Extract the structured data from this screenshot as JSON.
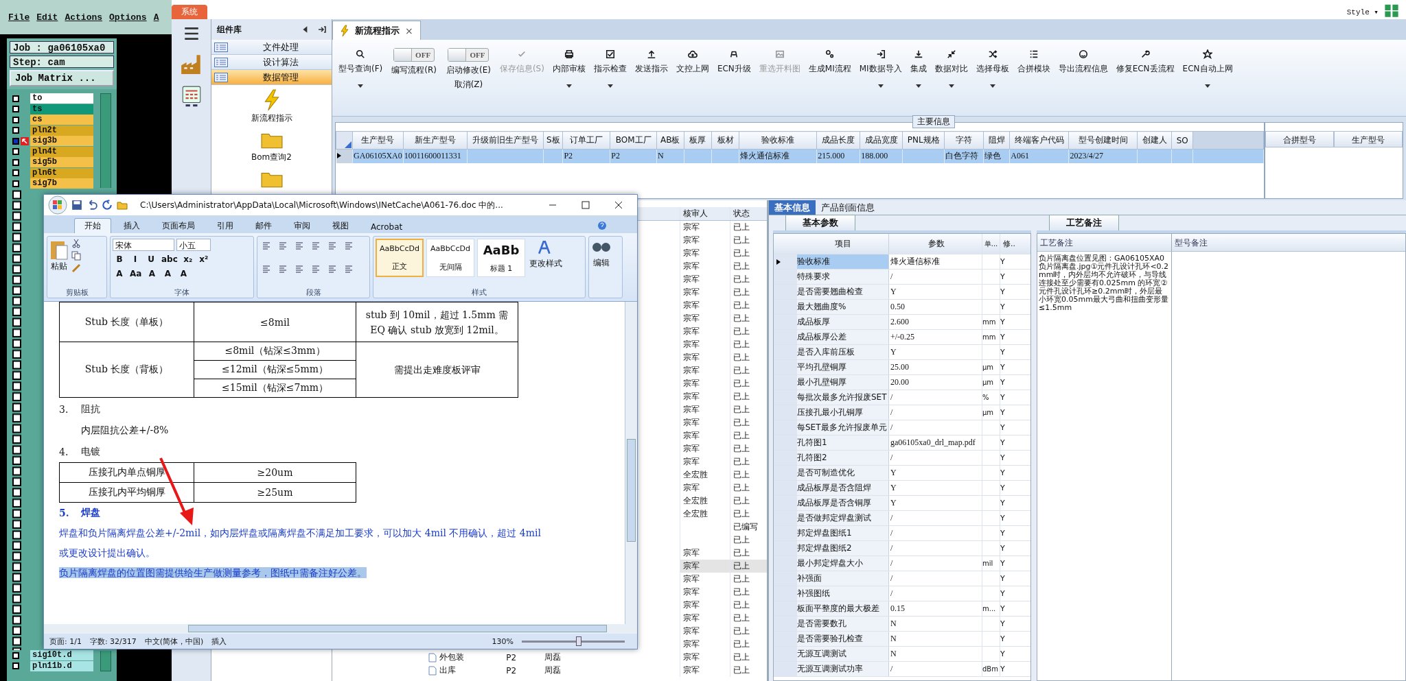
{
  "cam": {
    "menu": [
      "File",
      "Edit",
      "Actions",
      "Options",
      "A"
    ],
    "job": "Job : ga06105xa0",
    "step": "Step: cam",
    "matrix_button": "Job Matrix ...",
    "layers_top": [
      {
        "name": "to",
        "color": "#ffffff",
        "selected": false
      },
      {
        "name": "ts",
        "color": "#109878",
        "selected": false
      },
      {
        "name": "cs",
        "color": "#f4c048",
        "selected": false
      },
      {
        "name": "pln2t",
        "color": "#d8a820",
        "selected": false
      },
      {
        "name": "sig3b",
        "color": "#f4c048",
        "selected": true
      },
      {
        "name": "pln4t",
        "color": "#d8a820",
        "selected": false
      },
      {
        "name": "sig5b",
        "color": "#f4c048",
        "selected": false
      },
      {
        "name": "pln6t",
        "color": "#d8a820",
        "selected": false
      },
      {
        "name": "sig7b",
        "color": "#f4c048",
        "selected": false
      }
    ],
    "layers_bottom": [
      {
        "name": "sig10t.d",
        "color": "#a8e4e4",
        "selected": false
      },
      {
        "name": "pln11b.d",
        "color": "#a8e4e4",
        "selected": false
      }
    ]
  },
  "app": {
    "system_tab": "系统",
    "style_menu": "Style ▾"
  },
  "sidebar": {
    "title": "组件库",
    "items": [
      {
        "label": "文件处理",
        "selected": false
      },
      {
        "label": "设计算法",
        "selected": false
      },
      {
        "label": "数据管理",
        "selected": true
      }
    ],
    "tiles": [
      "新流程指示",
      "Bom查询2"
    ]
  },
  "doc_tab": {
    "label": "新流程指示",
    "close": "×"
  },
  "toolbar": [
    {
      "kind": "button",
      "label": "型号查询(F)",
      "disabled": false,
      "dropdown": true
    },
    {
      "kind": "toggle",
      "label": "编写流程(R)",
      "on": false,
      "state": "OFF"
    },
    {
      "kind": "toggle",
      "label": "启动修改(E)",
      "sublabel": "取消(Z)",
      "on": false,
      "state": "OFF"
    },
    {
      "kind": "button",
      "label": "保存信息(S)",
      "disabled": true,
      "dropdown": false
    },
    {
      "kind": "button",
      "label": "内部审核",
      "disabled": false,
      "dropdown": true
    },
    {
      "kind": "button",
      "label": "指示检查",
      "disabled": false,
      "dropdown": true
    },
    {
      "kind": "button",
      "label": "发送指示",
      "disabled": false,
      "dropdown": false
    },
    {
      "kind": "button",
      "label": "文控上网",
      "disabled": false,
      "dropdown": false
    },
    {
      "kind": "button",
      "label": "ECN升级",
      "disabled": false,
      "dropdown": false
    },
    {
      "kind": "button",
      "label": "重选开料图",
      "disabled": true,
      "dropdown": false
    },
    {
      "kind": "button",
      "label": "生成MI流程",
      "disabled": false,
      "dropdown": false
    },
    {
      "kind": "button",
      "label": "MI数据导入",
      "disabled": false,
      "dropdown": true
    },
    {
      "kind": "button",
      "label": "集成",
      "disabled": false,
      "dropdown": true
    },
    {
      "kind": "button",
      "label": "数据对比",
      "disabled": false,
      "dropdown": true
    },
    {
      "kind": "button",
      "label": "选择母板",
      "disabled": false,
      "dropdown": true
    },
    {
      "kind": "button",
      "label": "合拼模块",
      "disabled": false,
      "dropdown": false
    },
    {
      "kind": "button",
      "label": "导出流程信息",
      "disabled": false,
      "dropdown": false
    },
    {
      "kind": "button",
      "label": "修复ECN丢流程",
      "disabled": false,
      "dropdown": false
    },
    {
      "kind": "button",
      "label": "ECN自动上网",
      "disabled": false,
      "dropdown": true
    }
  ],
  "main_info": {
    "title": "主要信息",
    "columns": [
      "生产型号",
      "新生产型号",
      "升级前旧生产型号",
      "S板",
      "订单工厂",
      "BOM工厂",
      "AB板",
      "板厚",
      "板材",
      "验收标准",
      "成品长度",
      "成品宽度",
      "PNL规格",
      "字符",
      "阻焊",
      "终端客户代码",
      "型号创建时间",
      "创建人",
      "SO"
    ],
    "rows": [
      {
        "selected": true,
        "cells": [
          "GA06105XA0",
          "10011600011331",
          "",
          "",
          "P2",
          "P2",
          "N",
          "",
          "",
          "烽火通信标准",
          "215.000",
          "188.000",
          "",
          "白色字符",
          "绿色",
          "A061",
          "2023/4/27",
          "",
          ""
        ]
      }
    ],
    "side_columns": [
      "合拼型号",
      "生产型号"
    ]
  },
  "flow_list": {
    "columns": [
      "核审人",
      "状态"
    ],
    "rows": [
      {
        "reviewer": "宗军",
        "status": "已上",
        "selected": false
      },
      {
        "reviewer": "宗军",
        "status": "已上",
        "selected": false
      },
      {
        "reviewer": "宗军",
        "status": "已上",
        "selected": false
      },
      {
        "reviewer": "宗军",
        "status": "已上",
        "selected": false
      },
      {
        "reviewer": "宗军",
        "status": "已上",
        "selected": false
      },
      {
        "reviewer": "宗军",
        "status": "已上",
        "selected": false
      },
      {
        "reviewer": "宗军",
        "status": "已上",
        "selected": false
      },
      {
        "reviewer": "宗军",
        "status": "已上",
        "selected": false
      },
      {
        "reviewer": "宗军",
        "status": "已上",
        "selected": false
      },
      {
        "reviewer": "宗军",
        "status": "已上",
        "selected": false
      },
      {
        "reviewer": "宗军",
        "status": "已上",
        "selected": false
      },
      {
        "reviewer": "宗军",
        "status": "已上",
        "selected": false
      },
      {
        "reviewer": "宗军",
        "status": "已上",
        "selected": false
      },
      {
        "reviewer": "宗军",
        "status": "已上",
        "selected": false
      },
      {
        "reviewer": "宗军",
        "status": "已上",
        "selected": false
      },
      {
        "reviewer": "宗军",
        "status": "已上",
        "selected": false
      },
      {
        "reviewer": "宗军",
        "status": "已上",
        "selected": false
      },
      {
        "reviewer": "宗军",
        "status": "已上",
        "selected": false
      },
      {
        "reviewer": "宗军",
        "status": "已上",
        "selected": false
      },
      {
        "reviewer": "全宏胜",
        "status": "已上",
        "selected": false
      },
      {
        "reviewer": "宗军",
        "status": "已上",
        "selected": false
      },
      {
        "reviewer": "全宏胜",
        "status": "已上",
        "selected": false
      },
      {
        "reviewer": "全宏胜",
        "status": "已上",
        "selected": false
      },
      {
        "status": "已编写",
        "selected": false
      },
      {
        "status": "已上",
        "selected": false
      },
      {
        "reviewer": "宗军",
        "status": "已上",
        "selected": false
      },
      {
        "reviewer": "宗军",
        "status": "已上",
        "selected": true
      },
      {
        "reviewer": "宗军",
        "status": "已上",
        "selected": false
      },
      {
        "reviewer": "宗军",
        "status": "已上",
        "selected": false
      },
      {
        "reviewer": "宗军",
        "status": "已上",
        "selected": false
      },
      {
        "reviewer": "宗军",
        "status": "已上",
        "selected": false
      },
      {
        "reviewer": "宗军",
        "status": "已上",
        "selected": false
      },
      {
        "reviewer": "宗军",
        "status": "已上",
        "selected": false
      },
      {
        "name": "外包装",
        "factory": "P2",
        "person": "周磊",
        "reviewer": "宗军",
        "status": "已上",
        "selected": false
      },
      {
        "name": "出库",
        "factory": "P2",
        "person": "周磊",
        "reviewer": "宗军",
        "status": "已上",
        "selected": false
      }
    ]
  },
  "detail": {
    "tabs": [
      {
        "label": "基本信息",
        "selected": true
      },
      {
        "label": "产品剖面信息",
        "selected": false
      }
    ],
    "params": {
      "tab": "基本参数",
      "columns": [
        "项目",
        "参数",
        "单...",
        "修.."
      ],
      "rows": [
        {
          "item": "验收标准",
          "value": "烽火通信标准",
          "unit": "",
          "flag": "Y",
          "selected": true
        },
        {
          "item": "特殊要求",
          "value": "/",
          "unit": "",
          "flag": "Y",
          "selected": false
        },
        {
          "item": "是否需要翘曲检查",
          "value": "Y",
          "unit": "",
          "flag": "Y",
          "selected": false
        },
        {
          "item": "最大翘曲度%",
          "value": "0.50",
          "unit": "",
          "flag": "Y",
          "selected": false
        },
        {
          "item": "成品板厚",
          "value": "2.600",
          "unit": "mm",
          "flag": "Y",
          "selected": false
        },
        {
          "item": "成品板厚公差",
          "value": "+/-0.25",
          "unit": "mm",
          "flag": "Y",
          "selected": false
        },
        {
          "item": "是否入库前压板",
          "value": "Y",
          "unit": "",
          "flag": "Y",
          "selected": false
        },
        {
          "item": "平均孔壁铜厚",
          "value": "25.00",
          "unit": "μm",
          "flag": "Y",
          "selected": false
        },
        {
          "item": "最小孔壁铜厚",
          "value": "20.00",
          "unit": "μm",
          "flag": "Y",
          "selected": false
        },
        {
          "item": "每批次最多允许报废SET",
          "value": "/",
          "unit": "%",
          "flag": "Y",
          "selected": false
        },
        {
          "item": "压接孔最小孔铜厚",
          "value": "/",
          "unit": "μm",
          "flag": "Y",
          "selected": false
        },
        {
          "item": "每SET最多允许报废单元",
          "value": "/",
          "unit": "",
          "flag": "Y",
          "selected": false
        },
        {
          "item": "孔符图1",
          "value": "ga06105xa0_drl_map.pdf",
          "unit": "",
          "flag": "Y",
          "selected": false
        },
        {
          "item": "孔符图2",
          "value": "/",
          "unit": "",
          "flag": "Y",
          "selected": false
        },
        {
          "item": "是否可制造优化",
          "value": "Y",
          "unit": "",
          "flag": "Y",
          "selected": false
        },
        {
          "item": "成品板厚是否含阻焊",
          "value": "Y",
          "unit": "",
          "flag": "Y",
          "selected": false
        },
        {
          "item": "成品板厚是否含铜厚",
          "value": "Y",
          "unit": "",
          "flag": "Y",
          "selected": false
        },
        {
          "item": "是否做邦定焊盘测试",
          "value": "/",
          "unit": "",
          "flag": "Y",
          "selected": false
        },
        {
          "item": "邦定焊盘图纸1",
          "value": "/",
          "unit": "",
          "flag": "Y",
          "selected": false
        },
        {
          "item": "邦定焊盘图纸2",
          "value": "/",
          "unit": "",
          "flag": "Y",
          "selected": false
        },
        {
          "item": "最小邦定焊盘大小",
          "value": "/",
          "unit": "mil",
          "flag": "Y",
          "selected": false
        },
        {
          "item": "补强面",
          "value": "/",
          "unit": "",
          "flag": "Y",
          "selected": false
        },
        {
          "item": "补强图纸",
          "value": "/",
          "unit": "",
          "flag": "Y",
          "selected": false
        },
        {
          "item": "板面平整度的最大极差",
          "value": "0.15",
          "unit": "m...",
          "flag": "Y",
          "selected": false
        },
        {
          "item": "是否需要数孔",
          "value": "N",
          "unit": "",
          "flag": "Y",
          "selected": false
        },
        {
          "item": "是否需要验孔检查",
          "value": "N",
          "unit": "",
          "flag": "Y",
          "selected": false
        },
        {
          "item": "无源互调测试",
          "value": "N",
          "unit": "",
          "flag": "Y",
          "selected": false
        },
        {
          "item": "无源互调测试功率",
          "value": "/",
          "unit": "dBm",
          "flag": "Y",
          "selected": false
        }
      ]
    },
    "notes": {
      "tab": "工艺备注",
      "columns": [
        "工艺备注",
        "型号备注"
      ],
      "text": "负片隔离盘位置见图：GA06105XA0负片隔离盘.jpg①元件孔设计孔环<0.2mm时，内外层均不允许破环，与导线连接处至少需要有0.025mm 的环宽②元件孔设计孔环≥0.2mm时，外层最小环宽0.05mm最大弓曲和扭曲变形量≤1.5mm"
    }
  },
  "word": {
    "title": "C:\\Users\\Administrator\\AppData\\Local\\Microsoft\\Windows\\INetCache\\A061-76.doc 中的...",
    "tabs": [
      {
        "label": "开始",
        "selected": true
      },
      {
        "label": "插入",
        "selected": false
      },
      {
        "label": "页面布局",
        "selected": false
      },
      {
        "label": "引用",
        "selected": false
      },
      {
        "label": "邮件",
        "selected": false
      },
      {
        "label": "审阅",
        "selected": false
      },
      {
        "label": "视图",
        "selected": false
      },
      {
        "label": "Acrobat",
        "selected": false
      }
    ],
    "paste": "粘贴",
    "font": "宋体",
    "size": "小五",
    "format_row1": [
      "B",
      "I",
      "U",
      "abc",
      "x₂",
      "x²"
    ],
    "format_row2": [
      "A",
      "Aa",
      "A",
      "A",
      "A"
    ],
    "styles": [
      {
        "sample": "AaBbCcDd",
        "label": "正文",
        "selected": true,
        "kind": "normal"
      },
      {
        "sample": "AaBbCcDd",
        "label": "无间隔",
        "selected": false,
        "kind": "normal"
      },
      {
        "sample": "AaBb",
        "label": "标题 1",
        "selected": false,
        "kind": "heading"
      }
    ],
    "change_styles": "更改样式",
    "edit": "编辑",
    "groups": [
      "剪贴板",
      "字体",
      "段落",
      "样式"
    ],
    "table1": {
      "single": [
        "Stub 长度（单板）",
        "≤8mil",
        "stub 到 10mil，超过 1.5mm 需 EQ 确认 stub 放宽到 12mil。"
      ],
      "back": {
        "label": "Stub 长度（背板）",
        "values": [
          "≤8mil（钻深≤3mm）",
          "≤12mil（钻深≤5mm）",
          "≤15mil（钻深≤7mm）"
        ],
        "note": "需提出走难度板评审"
      }
    },
    "items": [
      {
        "num": "3.",
        "title": "阻抗",
        "body": "内层阻抗公差+/-8%"
      },
      {
        "num": "4.",
        "title": "电镀"
      }
    ],
    "table2": [
      [
        "压接孔内单点铜厚",
        "≥20um"
      ],
      [
        "压接孔内平均铜厚",
        "≥25um"
      ]
    ],
    "heading": {
      "num": "5.",
      "title": "焊盘"
    },
    "para": "焊盘和负片隔离焊盘公差+/-2mil，如内层焊盘或隔离焊盘不满足加工要求，可以加大 4mil 不用确认，超过 4mil 或更改设计提出确认。",
    "highlighted": "负片隔离焊盘的位置图需提供给生产做测量参考，图纸中需备注好公差。",
    "status": [
      "页面: 1/1",
      "字数: 32/317",
      "中文(简体，中国)",
      "插入"
    ],
    "zoom": "130%",
    "zoom_slider": {
      "level": 0.55
    }
  }
}
